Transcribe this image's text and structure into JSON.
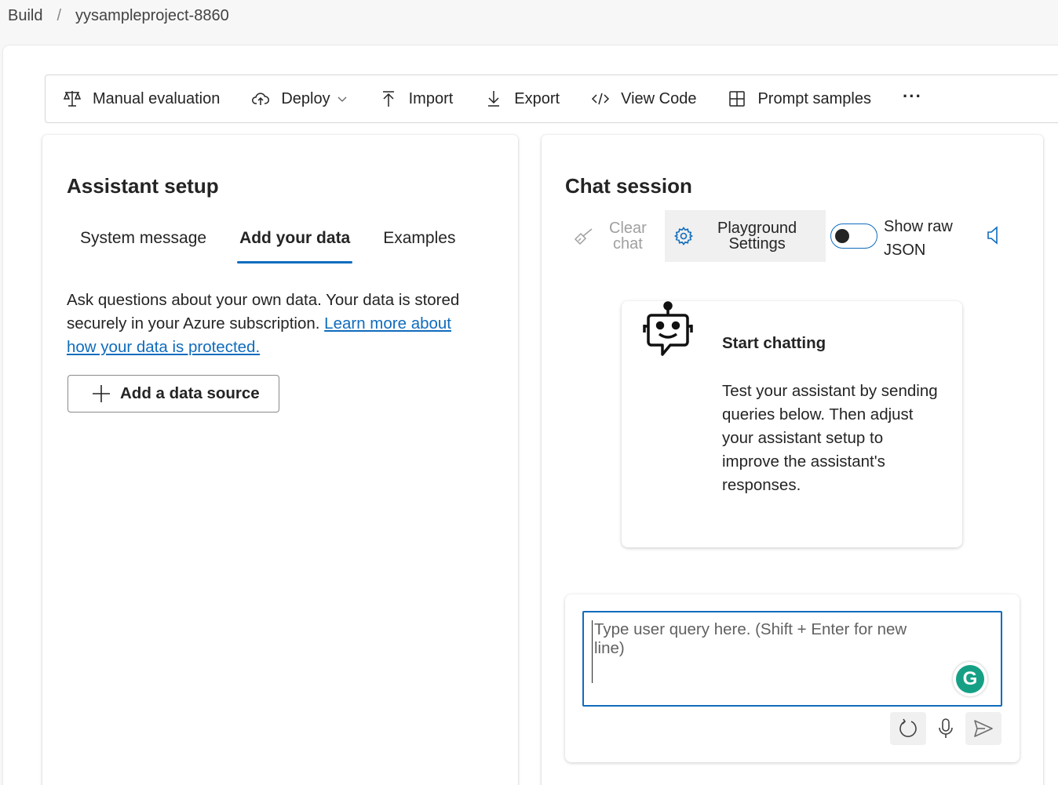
{
  "breadcrumb": {
    "root": "Build",
    "separator": "/",
    "project": "yysampleproject-8860"
  },
  "toolbar": {
    "manual_evaluation": "Manual evaluation",
    "deploy": "Deploy",
    "import": "Import",
    "export": "Export",
    "view_code": "View Code",
    "prompt_samples": "Prompt samples",
    "more": "···"
  },
  "assistant_setup": {
    "title": "Assistant setup",
    "tabs": [
      {
        "label": "System message",
        "active": false
      },
      {
        "label": "Add your data",
        "active": true
      },
      {
        "label": "Examples",
        "active": false
      }
    ],
    "description": "Ask questions about your own data. Your data is stored securely in your Azure subscription.",
    "learn_more_link": "Learn more about how your data is protected.",
    "add_source_button": "Add a data source"
  },
  "chat_session": {
    "title": "Chat session",
    "clear_chat_line1": "Clear",
    "clear_chat_line2": "chat",
    "playground_settings_line1": "Playground",
    "playground_settings_line2": "Settings",
    "show_raw_json_line1": "Show raw",
    "show_raw_json_line2": "JSON",
    "show_raw_json_on": false,
    "start_card": {
      "title": "Start chatting",
      "body": "Test your assistant by sending queries below. Then adjust your assistant setup to improve the assistant's responses."
    },
    "query_placeholder": "Type user query here. (Shift + Enter for new line)",
    "grammarly_letter": "G"
  },
  "colors": {
    "accent": "#0f6cbd",
    "grammarly": "#15a085",
    "disabled_text": "#a0a0a0"
  },
  "icons": [
    "scale-icon",
    "cloud-upload-icon",
    "chevron-down-icon",
    "import-arrow-icon",
    "export-arrow-icon",
    "code-icon",
    "grid-icon",
    "more-icon",
    "plus-icon",
    "broom-icon",
    "gear-icon",
    "speaker-icon",
    "robot-icon",
    "refresh-icon",
    "microphone-icon",
    "send-icon"
  ]
}
